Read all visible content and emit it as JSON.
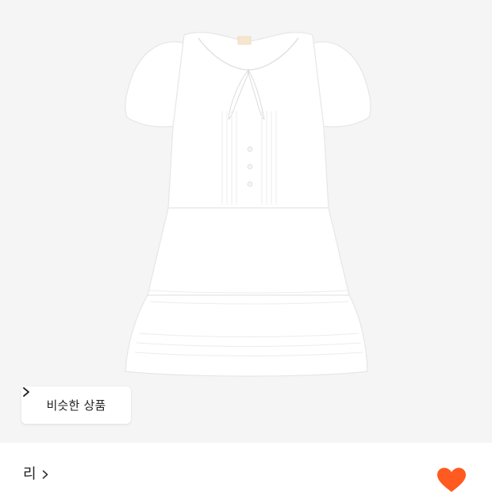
{
  "similar_products": {
    "label": "비슷한 상품",
    "icon": "chevron-right-icon"
  },
  "brand": {
    "name": "리",
    "icon": "chevron-right-icon"
  },
  "like": {
    "icon": "heart-icon",
    "color": "#ff5a1f"
  },
  "colors": {
    "image_background": "#f5f5f5",
    "garment": "#ffffff"
  }
}
